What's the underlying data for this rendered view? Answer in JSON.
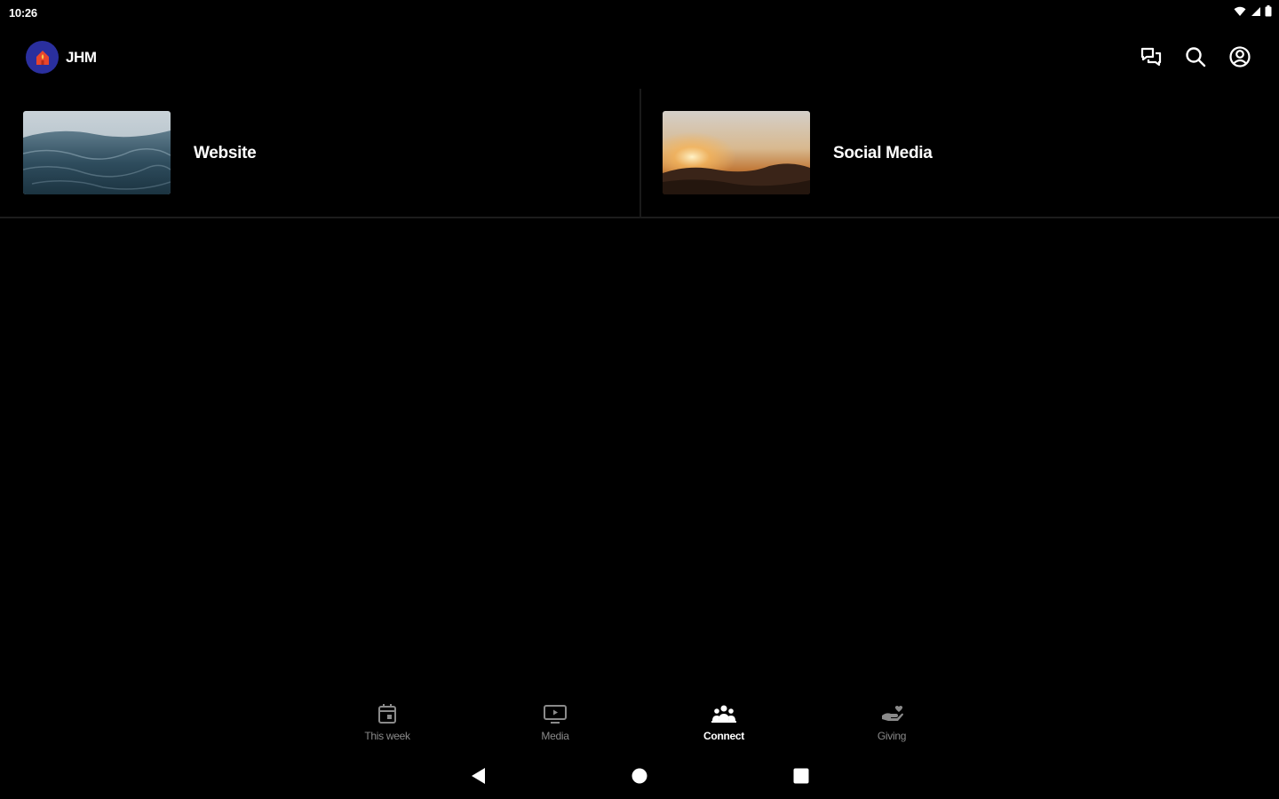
{
  "status_bar": {
    "time": "10:26",
    "icons": [
      "wifi-icon",
      "cell-signal-icon",
      "battery-icon"
    ]
  },
  "app_bar": {
    "title": "JHM",
    "logo_icon": "church-logo-icon",
    "actions": [
      "chat-icon",
      "search-icon",
      "account-icon"
    ]
  },
  "tiles": [
    {
      "label": "Website",
      "image": "ocean-waves-image"
    },
    {
      "label": "Social Media",
      "image": "sunset-mountains-image"
    }
  ],
  "bottom_nav": {
    "items": [
      {
        "label": "This week",
        "icon": "calendar-icon",
        "active": false
      },
      {
        "label": "Media",
        "icon": "media-play-icon",
        "active": false
      },
      {
        "label": "Connect",
        "icon": "people-group-icon",
        "active": true
      },
      {
        "label": "Giving",
        "icon": "giving-hand-icon",
        "active": false
      }
    ]
  },
  "system_nav": [
    "back-icon",
    "home-icon",
    "recents-icon"
  ],
  "colors": {
    "background": "#000000",
    "logo_bg": "#2a2f9e",
    "logo_accent": "#e8452c",
    "inactive_label": "#8a8a8a",
    "divider": "#1c1c1c"
  }
}
